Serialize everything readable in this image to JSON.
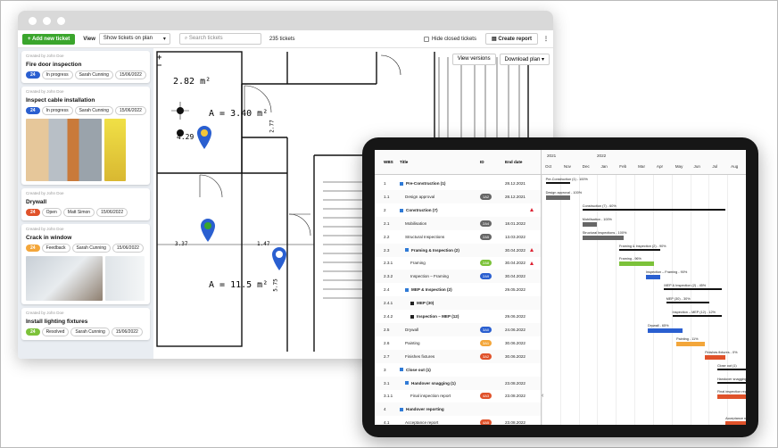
{
  "toolbar": {
    "add_label": "+ Add new ticket",
    "view_label": "View",
    "view_select": "Show tickets on plan",
    "search_placeholder": "Search tickets",
    "count": "235 tickets",
    "hide_closed": "Hide closed tickets",
    "report": "Create report",
    "more": "⋮"
  },
  "plan": {
    "view_versions": "View versions",
    "download": "Download plan",
    "zoom_in": "+",
    "zoom_out": "−",
    "dim1": "2.82 m²",
    "dim2": "A = 3.40 m²",
    "dim3": "4.29",
    "dim4": "A = 11.5 m²",
    "dim5": "3.37",
    "dim6": "1.47",
    "dim7": "5.75",
    "dim8": "2.77"
  },
  "tickets": [
    {
      "by": "Created by John Doe",
      "title": "Fire door inspection",
      "num": "24",
      "num_color": "#2a5fd0",
      "status": "In progress",
      "person": "Sarah Cunning",
      "date": "15/06/2022"
    },
    {
      "by": "Created by John Doe",
      "title": "Inspect cable installation",
      "num": "24",
      "num_color": "#2a5fd0",
      "status": "In progress",
      "person": "Sarah Cunning",
      "date": "15/06/2022"
    },
    {
      "by": "Created by John Doe",
      "title": "Drywall",
      "num": "24",
      "num_color": "#e0522a",
      "status": "Open",
      "person": "Matt Simon",
      "date": "15/06/2022"
    },
    {
      "by": "Created by John Doe",
      "title": "Crack in window",
      "num": "24",
      "num_color": "#f3a63a",
      "status": "Feedback",
      "person": "Sarah Cunning",
      "date": "15/06/2022"
    },
    {
      "by": "Created by John Doe",
      "title": "Install lighting fixtures",
      "num": "24",
      "num_color": "#7cc23a",
      "status": "Resolved",
      "person": "Sarah Cunning",
      "date": "15/06/2022"
    }
  ],
  "gantt": {
    "headers": {
      "wbs": "WBS",
      "title": "Title",
      "id": "ID",
      "end": "End date"
    },
    "years": [
      "2021",
      "2022"
    ],
    "months": [
      "Oct",
      "Nov",
      "Dec",
      "Jan",
      "Feb",
      "Mar",
      "Apr",
      "May",
      "Jun",
      "Jul",
      "Aug"
    ],
    "rows": [
      {
        "wbs": "1",
        "title": "Pre-Construction (1)",
        "id": "",
        "date": "28.12.2021",
        "bold": true,
        "exp": "blue"
      },
      {
        "wbs": "1.1",
        "title": "Design approval",
        "id": "1A2",
        "id_color": "#666",
        "date": "28.12.2021"
      },
      {
        "wbs": "2",
        "title": "Construction (7)",
        "id": "",
        "date": "",
        "bold": true,
        "exp": "blue",
        "warn": true
      },
      {
        "wbs": "2.1",
        "title": "Mobilisation",
        "id": "2A4",
        "id_color": "#666",
        "date": "18.01.2022"
      },
      {
        "wbs": "2.2",
        "title": "Structural Inspections",
        "id": "2A5",
        "id_color": "#666",
        "date": "13.03.2022"
      },
      {
        "wbs": "2.3",
        "title": "Framing & Inspection (2)",
        "id": "",
        "date": "30.04.2022",
        "bold": true,
        "exp": "blue",
        "warn": true
      },
      {
        "wbs": "2.3.1",
        "title": "Framing",
        "id": "2A8",
        "id_color": "#7cc23a",
        "date": "30.04.2022",
        "warn": true
      },
      {
        "wbs": "2.3.2",
        "title": "Inspection – Framing",
        "id": "2A9",
        "id_color": "#2a5fd0",
        "date": "30.04.2022"
      },
      {
        "wbs": "2.4",
        "title": "MEP & Inspection (2)",
        "id": "",
        "date": "29.05.2022",
        "bold": true,
        "exp": "blue"
      },
      {
        "wbs": "2.4.1",
        "title": "MEP (30)",
        "id": "",
        "date": "",
        "bold": true,
        "exp": "black"
      },
      {
        "wbs": "2.4.2",
        "title": "Inspection – MEP (12)",
        "id": "",
        "date": "29.06.2022",
        "bold": true,
        "exp": "black"
      },
      {
        "wbs": "2.5",
        "title": "Drywall",
        "id": "3A0",
        "id_color": "#2a5fd0",
        "date": "24.06.2022"
      },
      {
        "wbs": "2.6",
        "title": "Painting",
        "id": "3A1",
        "id_color": "#f3a63a",
        "date": "30.06.2022"
      },
      {
        "wbs": "2.7",
        "title": "Finishes fixtures",
        "id": "3A2",
        "id_color": "#e0522a",
        "date": "30.06.2022"
      },
      {
        "wbs": "3",
        "title": "Close out (1)",
        "id": "",
        "date": "",
        "bold": true,
        "exp": "blue"
      },
      {
        "wbs": "3.1",
        "title": "Handover snagging (1)",
        "id": "",
        "date": "23.08.2022",
        "bold": true,
        "exp": "blue"
      },
      {
        "wbs": "3.1.1",
        "title": "Final inspection report",
        "id": "4A3",
        "id_color": "#e0522a",
        "date": "23.08.2022"
      },
      {
        "wbs": "4",
        "title": "Handover reporting",
        "id": "",
        "date": "",
        "bold": true,
        "exp": "blue"
      },
      {
        "wbs": "4.1",
        "title": "Acceptance report",
        "id": "4A5",
        "id_color": "#e0522a",
        "date": "23.08.2022"
      }
    ],
    "bars": [
      {
        "label": "Pre-Construction (1) - 100%",
        "color": "#111",
        "row": 0,
        "start": 0.02,
        "end": 0.14,
        "summary": true
      },
      {
        "label": "Design approval - 100%",
        "color": "#666",
        "row": 1,
        "start": 0.02,
        "end": 0.14
      },
      {
        "label": "Construction (7) - 60%",
        "color": "#111",
        "row": 2,
        "start": 0.2,
        "end": 0.9,
        "summary": true
      },
      {
        "label": "Mobilisation - 100%",
        "color": "#666",
        "row": 3,
        "start": 0.2,
        "end": 0.27
      },
      {
        "label": "Structural Inspections - 100%",
        "color": "#666",
        "row": 4,
        "start": 0.2,
        "end": 0.4
      },
      {
        "label": "Framing & Inspection (2) - 90%",
        "color": "#111",
        "row": 5,
        "start": 0.38,
        "end": 0.58,
        "summary": true
      },
      {
        "label": "Framing - 96%",
        "color": "#7cc23a",
        "row": 6,
        "start": 0.38,
        "end": 0.55
      },
      {
        "label": "Inspection – Framing - 90%",
        "color": "#2a5fd0",
        "row": 7,
        "start": 0.51,
        "end": 0.58
      },
      {
        "label": "MEP & Inspection (2) - 45%",
        "color": "#111",
        "row": 8,
        "start": 0.6,
        "end": 0.88,
        "summary": true
      },
      {
        "label": "MEP (30) - 30%",
        "color": "#111",
        "row": 9,
        "start": 0.61,
        "end": 0.82,
        "summary": true
      },
      {
        "label": "Inspection – MEP (12) - 12%",
        "color": "#111",
        "row": 10,
        "start": 0.64,
        "end": 0.88,
        "summary": true
      },
      {
        "label": "Drywall - 65%",
        "color": "#2a5fd0",
        "row": 11,
        "start": 0.52,
        "end": 0.69
      },
      {
        "label": "Painting - 11%",
        "color": "#f3a63a",
        "row": 12,
        "start": 0.66,
        "end": 0.8
      },
      {
        "label": "Finishes fixtures - 0%",
        "color": "#e0522a",
        "row": 13,
        "start": 0.8,
        "end": 0.9
      },
      {
        "label": "Close out (1)",
        "color": "#111",
        "row": 14,
        "start": 0.86,
        "end": 1.0,
        "summary": true
      },
      {
        "label": "Handover snagging",
        "color": "#111",
        "row": 15,
        "start": 0.86,
        "end": 1.0,
        "summary": true
      },
      {
        "label": "Final inspection report",
        "color": "#e0522a",
        "row": 16,
        "start": 0.86,
        "end": 1.0
      },
      {
        "label": "Acceptance report",
        "color": "#e0522a",
        "row": 18,
        "start": 0.9,
        "end": 1.0
      }
    ]
  }
}
